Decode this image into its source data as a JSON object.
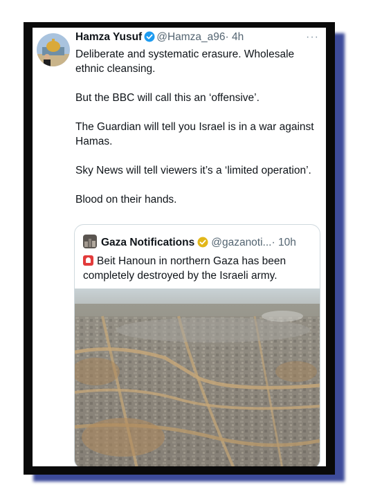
{
  "tweet": {
    "author_name": "Hamza Yusuf",
    "handle": "@Hamza_a96",
    "time": "· 4h",
    "more": "···",
    "paragraphs": [
      "Deliberate and systematic erasure. Wholesale ethnic cleansing.",
      "But the BBC will call this an ‘offensive’.",
      "The Guardian will tell you Israel is in a war against Hamas.",
      "Sky News will tell viewers it’s a ‘limited operation’.",
      "Blood on their hands."
    ],
    "verified_color": "#1d9bf0"
  },
  "quoted": {
    "author_name": "Gaza Notifications",
    "handle": "@gazanoti...",
    "time": "· 10h",
    "text": "Beit Hanoun in northern Gaza has been completely destroyed by the Israeli army.",
    "verified_color": "#e2b719",
    "alert_icon": "rotating-light-icon"
  },
  "colors": {
    "frame": "#0a0a0a",
    "shadow": "#3d4b9a"
  }
}
